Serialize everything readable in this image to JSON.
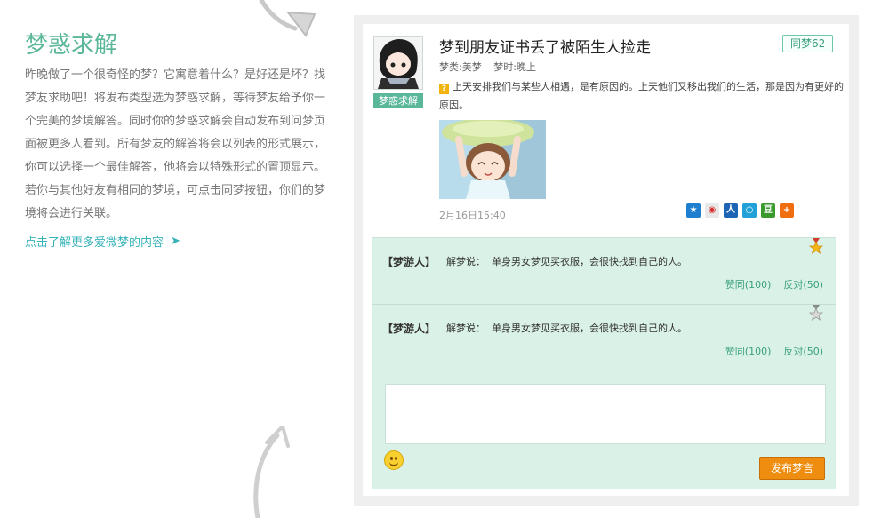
{
  "intro": {
    "title": "梦惑求解",
    "body": "昨晚做了一个很奇怪的梦？它寓意着什么？是好还是坏？找梦友求助吧！将发布类型选为梦惑求解，等待梦友给予你一个完美的梦境解答。同时你的梦惑求解会自动发布到问梦页面被更多人看到。所有梦友的解答将会以列表的形式展示，你可以选择一个最佳解答，他将会以特殊形式的置顶显示。若你与其他好友有相同的梦境，可点击同梦按钮，你们的梦境将会进行关联。",
    "link": "点击了解更多爱微梦的内容",
    "link_arrow": "➤"
  },
  "post": {
    "avatar_tag": "梦惑求解",
    "title": "梦到朋友证书丢了被陌生人捡走",
    "same_dream": "同梦62",
    "type": "梦类:美梦",
    "time": "梦时:晚上",
    "question_mark": "?",
    "description": "上天安排我们与某些人相遇，是有原因的。上天他们又移出我们的生活，那是因为有更好的原因。",
    "date": "2月16日15:40",
    "share_icons": [
      "qzone-icon",
      "weibo-icon",
      "renren-icon",
      "tqq-icon",
      "douban-icon",
      "more-icon"
    ]
  },
  "comments": [
    {
      "author": "【梦游人】",
      "label": "解梦说：",
      "text": "单身男女梦见买衣服，会很快找到自己的人。",
      "agree": "赞同(100)",
      "oppose": "反对(50)",
      "badge": "gold-medal-icon"
    },
    {
      "author": "【梦游人】",
      "label": "解梦说：",
      "text": "单身男女梦见买衣服，会很快找到自己的人。",
      "agree": "赞同(100)",
      "oppose": "反对(50)",
      "badge": "silver-medal-icon"
    }
  ],
  "reply": {
    "value": "",
    "submit": "发布梦言"
  },
  "colors": {
    "accent": "#5bb79a",
    "link": "#37b3b8",
    "comment_bg": "#daf1e7",
    "button": "#ef8d10"
  }
}
